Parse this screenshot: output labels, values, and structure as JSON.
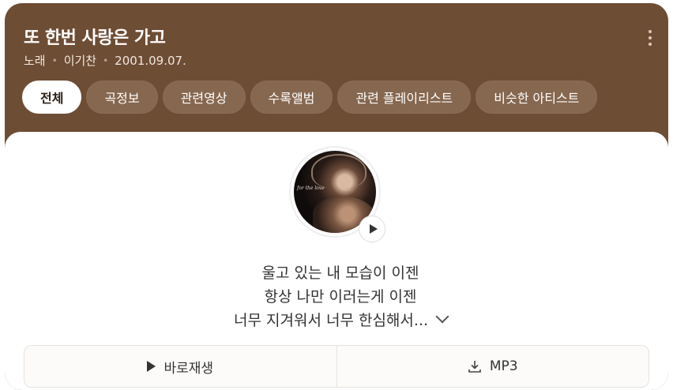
{
  "song": {
    "title": "또 한번 사랑은 가고",
    "type": "노래",
    "artist": "이기찬",
    "release_date": "2001.09.07."
  },
  "tabs": [
    {
      "label": "전체",
      "active": true
    },
    {
      "label": "곡정보"
    },
    {
      "label": "관련영상"
    },
    {
      "label": "수록앨범"
    },
    {
      "label": "관련 플레이리스트"
    },
    {
      "label": "비슷한 아티스트"
    }
  ],
  "lyrics": {
    "line1": "울고 있는 내 모습이 이젠",
    "line2": "항상 나만 이러는게 이젠",
    "line3": "너무 지겨워서 너무 한심해서..."
  },
  "actions": {
    "play_label": "바로재생",
    "mp3_label": "MP3"
  },
  "colors": {
    "header_bg": "#6e4d35",
    "tab_bg": "#86674f"
  },
  "icons": [
    "more-vert-icon",
    "play-icon",
    "chevron-down-icon",
    "download-icon"
  ]
}
